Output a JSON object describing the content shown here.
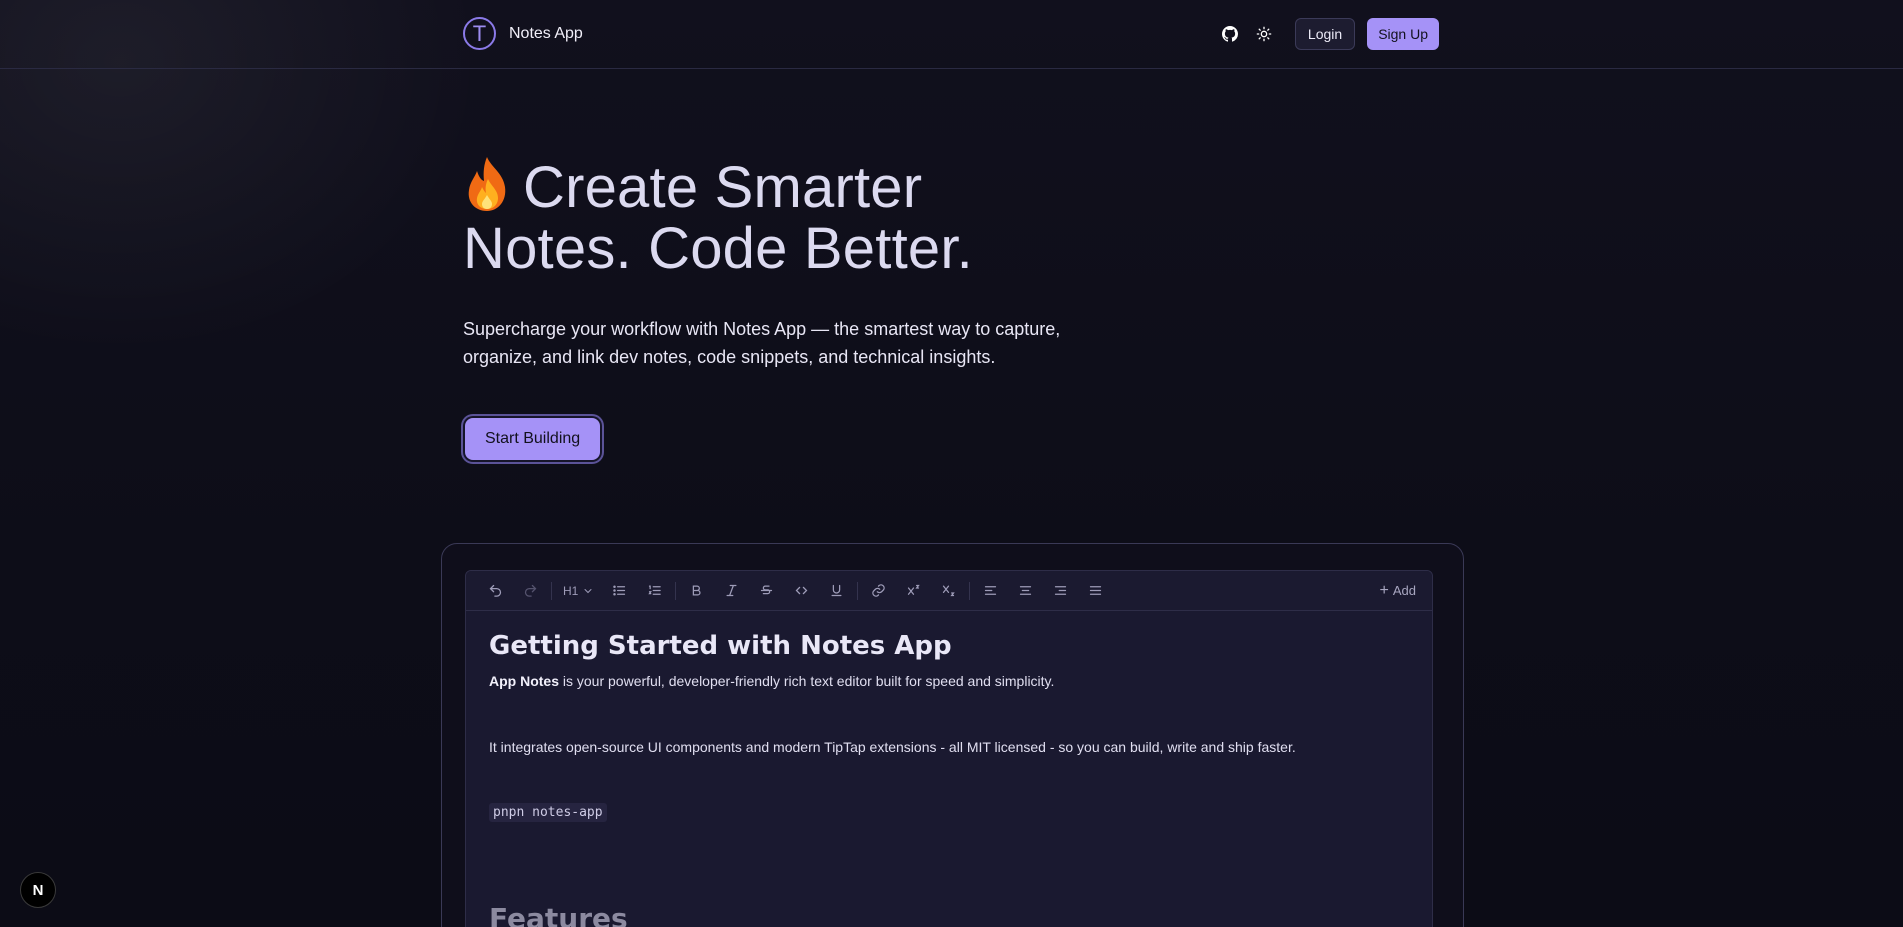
{
  "header": {
    "logo_letter": "T",
    "app_name": "Notes App",
    "login_label": "Login",
    "signup_label": "Sign Up",
    "icons": [
      "github-icon",
      "sun-icon"
    ]
  },
  "hero": {
    "title_line1": "Create Smarter",
    "title_line2": "Notes. Code Better.",
    "emoji": "fire-emoji",
    "subtitle": "Supercharge your workflow with Notes App — the smartest way to capture, organize, and link dev notes, code snippets, and technical insights.",
    "cta_label": "Start Building"
  },
  "editor": {
    "toolbar": {
      "heading_label": "H1",
      "add_label": "Add"
    },
    "doc": {
      "title": "Getting Started with Notes App",
      "intro_bold": "App Notes",
      "intro_rest": " is your powerful, developer-friendly rich text editor built for speed and simplicity.",
      "paragraph2": "It integrates open-source UI components and modern TipTap extensions - all MIT licensed - so you can build, write and ship faster.",
      "code": "pnpn notes-app",
      "section_heading": "Features"
    }
  },
  "badge": {
    "letter": "N"
  },
  "colors": {
    "accent": "#a592f7",
    "background": "#0d0d18",
    "editor_bg": "#1a1930"
  }
}
